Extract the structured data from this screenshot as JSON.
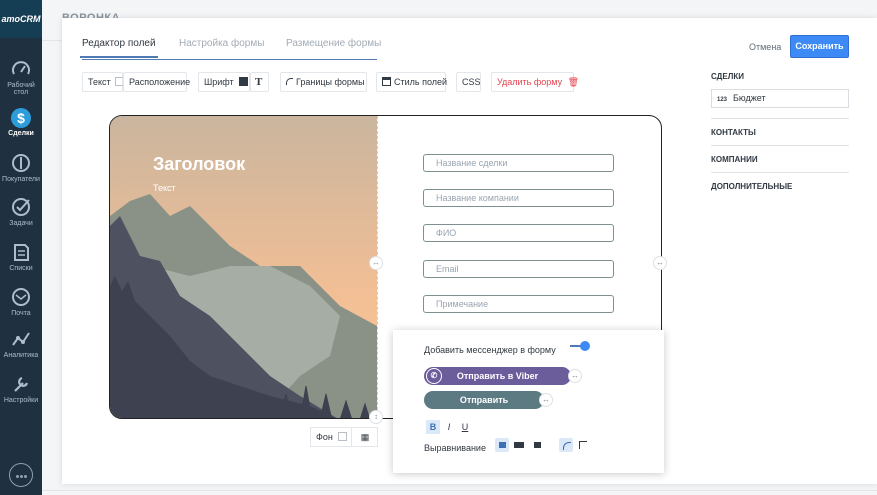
{
  "app": {
    "logo": "amoCRM"
  },
  "sidebar": {
    "items": [
      {
        "label": "Рабочий стол",
        "icon": "dashboard-icon"
      },
      {
        "label": "Сделки",
        "icon": "deals-icon"
      },
      {
        "label": "Покупатели",
        "icon": "customers-icon"
      },
      {
        "label": "Задачи",
        "icon": "tasks-icon"
      },
      {
        "label": "Списки",
        "icon": "lists-icon"
      },
      {
        "label": "Почта",
        "icon": "mail-icon"
      },
      {
        "label": "Аналитика",
        "icon": "analytics-icon"
      },
      {
        "label": "Настройки",
        "icon": "settings-icon"
      }
    ]
  },
  "background": {
    "page_title": "ВОРОНКА"
  },
  "editor": {
    "tabs": [
      "Редактор полей",
      "Настройка формы",
      "Размещение формы"
    ],
    "cancel_label": "Отмена",
    "save_label": "Сохранить",
    "toolbar": {
      "text": "Текст",
      "layout": "Расположение",
      "font": "Шрифт",
      "borders": "Границы формы",
      "field_style": "Стиль полей",
      "css": "CSS",
      "delete": "Удалить форму"
    },
    "preview": {
      "heading": "Заголовок",
      "subheading": "Текст",
      "fields": [
        "Название сделки",
        "Название компании",
        "ФИО",
        "Email",
        "Примечание"
      ]
    },
    "background_button": {
      "label": "Фон"
    }
  },
  "buttons_popup": {
    "add_messenger": "Добавить мессенджер в форму",
    "viber_label": "Отправить в Viber",
    "send_label": "Отправить",
    "bold": "B",
    "italic": "I",
    "underline": "U",
    "alignment_label": "Выравнивание"
  },
  "right_panel": {
    "sections": [
      "СДЕЛКИ",
      "КОНТАКТЫ",
      "КОМПАНИИ",
      "ДОПОЛНИТЕЛЬНЫЕ"
    ],
    "budget_prefix": "123",
    "budget_field": "Бюджет"
  },
  "colors": {
    "accent": "#3d8af7",
    "sidebar": "#1f3140",
    "delete": "#e5444f",
    "viber": "#6b5d9c",
    "send": "#5b7a82"
  }
}
